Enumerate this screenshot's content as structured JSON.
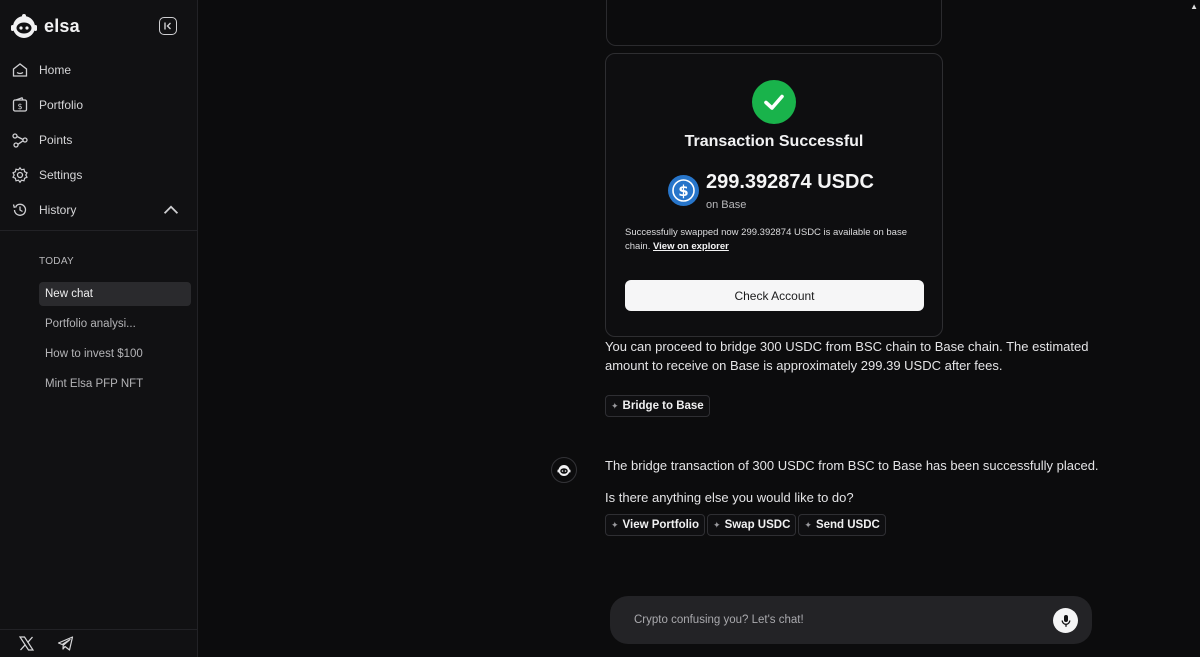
{
  "app": {
    "name": "elsa"
  },
  "nav": {
    "home": "Home",
    "portfolio": "Portfolio",
    "points": "Points",
    "settings": "Settings",
    "history": "History"
  },
  "history": {
    "section_label": "TODAY",
    "items": [
      "New chat",
      "Portfolio analysi...",
      "How to invest $100",
      "Mint Elsa PFP NFT"
    ]
  },
  "transaction": {
    "title": "Transaction Successful",
    "amount": "299.392874 USDC",
    "chain": "on Base",
    "description": "Successfully swapped now 299.392874 USDC is available on base chain.",
    "explorer_link": "View on explorer",
    "check_button": "Check Account"
  },
  "messages": {
    "bridge_info": "You can proceed to bridge 300 USDC from BSC chain to Base chain. The estimated amount to receive on Base is approximately 299.39 USDC after fees.",
    "bridge_chip": "Bridge to Base",
    "bridge_placed": "The bridge transaction of 300 USDC from BSC to Base has been successfully placed.",
    "followup": "Is there anything else you would like to do?",
    "actions": [
      "View Portfolio",
      "Swap USDC",
      "Send USDC"
    ]
  },
  "input": {
    "placeholder": "Crypto confusing you? Let's chat!"
  },
  "icons": {
    "home": "home-icon",
    "portfolio": "wallet-icon",
    "points": "points-icon",
    "settings": "gear-icon",
    "history": "history-icon",
    "x": "x-logo-icon",
    "telegram": "telegram-icon",
    "mic": "mic-icon",
    "check": "check-icon",
    "usdc": "usdc-icon"
  },
  "colors": {
    "success": "#19b34b",
    "usdc": "#2775ca",
    "background": "#0c0c0d"
  }
}
